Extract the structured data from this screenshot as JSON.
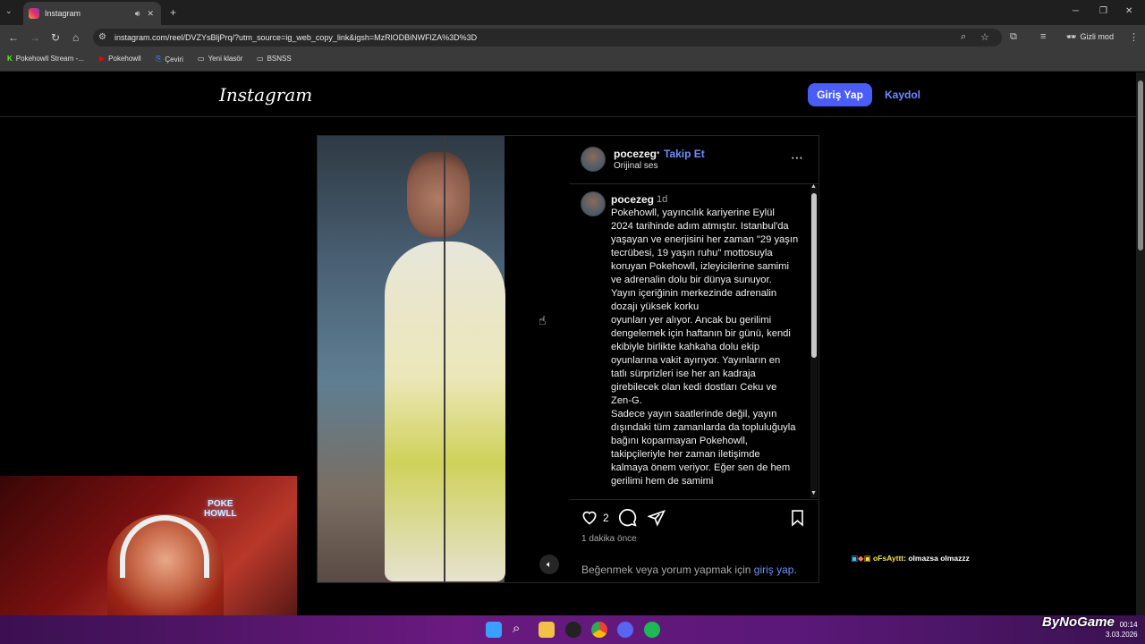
{
  "browser": {
    "tab_title": "Instagram",
    "url": "instagram.com/reel/DVZYsBljPrq/?utm_source=ig_web_copy_link&igsh=MzRlODBiNWFlZA%3D%3D",
    "incognito_label": "Gizli mod",
    "bookmarks": [
      "Pokehowll Stream -...",
      "Pokehowll",
      "Çeviri",
      "Yeni klasör",
      "BSNSS"
    ]
  },
  "instagram": {
    "logo": "Instagram",
    "login_button": "Giriş Yap",
    "signup_link": "Kaydol"
  },
  "post": {
    "username": "pocezeg",
    "separator": "•",
    "follow_label": "Takip Et",
    "audio": "Orijinal ses",
    "more_icon": "⋯",
    "caption_user": "pocezeg",
    "caption_time": "1d",
    "caption": "Pokehowll, yayıncılık kariyerine Eylül 2024 tarihinde adım atmıştır. Istanbul'da yaşayan ve enerjisini her zaman \"29 yaşın tecrübesi, 19 yaşın ruhu\" mottosuyla koruyan Pokehowll, izleyicilerine samimi ve adrenalin dolu bir dünya sunuyor.\nYayın içeriğinin merkezinde adrenalin dozajı yüksek korku\noyunları yer alıyor. Ancak bu gerilimi dengelemek için haftanın bir günü, kendi ekibiyle birlikte kahkaha dolu ekip oyunlarına vakit ayırıyor. Yayınların en tatlı sürprizleri ise her an kadraja girebilecek olan kedi dostları Ceku ve Zen-G.\nSadece yayın saatlerinde değil, yayın dışındaki tüm zamanlarda da topluluğuyla bağını koparmayan Pokehowll, takipçileriyle her zaman iletişimde kalmaya önem veriyor. Eğer sen de hem gerilimi hem de samimi",
    "likes_count": "2",
    "posted_ago": "1 dakika önce",
    "login_hint_prefix": "Beğenmek veya yorum yapmak için",
    "login_hint_link": "giriş yap",
    "login_hint_suffix": "."
  },
  "stream_overlay": {
    "neon_sign": "POKE\nHOWLL",
    "chat_user": "oFsAyttt",
    "chat_message": ": olmazsa olmazzz",
    "brand": "ByNoGame"
  },
  "taskbar": {
    "time": "00:14",
    "date": "3.03.2026"
  }
}
